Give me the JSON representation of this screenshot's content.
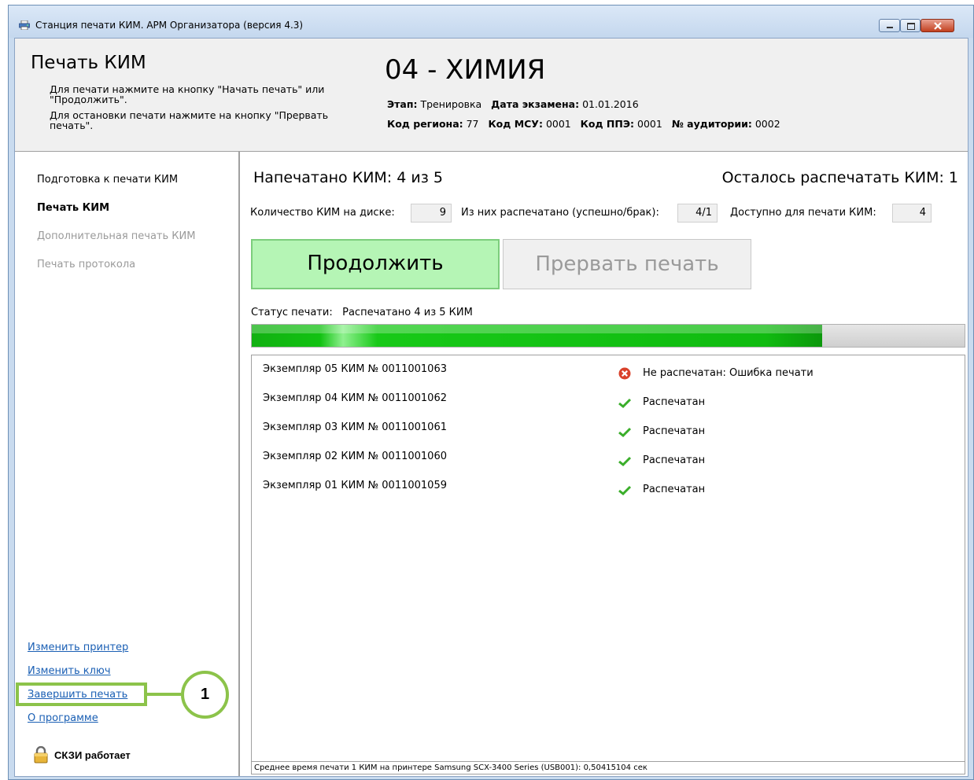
{
  "window": {
    "title": "Станция печати КИМ. АРМ Организатора (версия 4.3)",
    "controls": [
      "minimize-icon",
      "maximize-icon",
      "close-icon"
    ]
  },
  "header": {
    "page_title": "Печать КИМ",
    "hint_lines": [
      "Для печати нажмите на кнопку \"Начать печать\" или",
      "\"Продолжить\".",
      "Для остановки печати нажмите на кнопку \"Прервать",
      "печать\"."
    ],
    "exam_title": "04 - ХИМИЯ",
    "meta": {
      "stage_label": "Этап:",
      "stage_value": "Тренировка",
      "exam_date_label": "Дата экзамена:",
      "exam_date_value": "01.01.2016",
      "region_label": "Код региона:",
      "region_value": "77",
      "msu_label": "Код МСУ:",
      "msu_value": "0001",
      "ppe_label": "Код ППЭ:",
      "ppe_value": "0001",
      "room_label": "№ аудитории:",
      "room_value": "0002"
    }
  },
  "sidebar": {
    "nav": [
      {
        "label": "Подготовка к печати КИМ",
        "state": "normal"
      },
      {
        "label": "Печать КИМ",
        "state": "active"
      },
      {
        "label": "Дополнительная печать КИМ",
        "state": "disabled"
      },
      {
        "label": "Печать протокола",
        "state": "disabled"
      }
    ],
    "links": {
      "change_printer": "Изменить принтер",
      "change_key": "Изменить ключ",
      "finish_printing": "Завершить печать",
      "about": "О программе"
    },
    "callout_number": "1",
    "crypto_status": "СКЗИ работает",
    "highlight_color": "#8cc34a"
  },
  "main": {
    "printed_count": "Напечатано КИМ:  4  из  5",
    "remaining_count": "Осталось распечатать КИМ:  1",
    "disk_count_label": "Количество КИМ на диске:",
    "disk_count_value": "9",
    "printed_ok_label": "Из них распечатано (успешно/брак):",
    "printed_ok_value": "4/1",
    "available_label": "Доступно для печати КИМ:",
    "available_value": "4",
    "continue_label": "Продолжить",
    "abort_label": "Прервать печать",
    "status_label": "Статус печати:",
    "status_value": "Распечатано 4 из 5 КИМ",
    "progress_fraction": 0.8,
    "log": [
      {
        "copy": "Экземпляр 05  КИМ № 0011001063",
        "status": "Не распечатан: Ошибка печати",
        "icon": "error-icon"
      },
      {
        "copy": "Экземпляр 04  КИМ № 0011001062",
        "status": "Распечатан",
        "icon": "check-icon"
      },
      {
        "copy": "Экземпляр 03  КИМ № 0011001061",
        "status": "Распечатан",
        "icon": "check-icon"
      },
      {
        "copy": "Экземпляр 02  КИМ № 0011001060",
        "status": "Распечатан",
        "icon": "check-icon"
      },
      {
        "copy": "Экземпляр 01  КИМ № 0011001059",
        "status": "Распечатан",
        "icon": "check-icon"
      }
    ],
    "footer_note": "Среднее время печати 1 КИМ на принтере Samsung SCX-3400 Series (USB001): 0,50415104 сек",
    "colors": {
      "continue_bg": "#b5f5b5",
      "progress": "#12c212",
      "error": "#d9412b",
      "check": "#3aae2a"
    }
  }
}
